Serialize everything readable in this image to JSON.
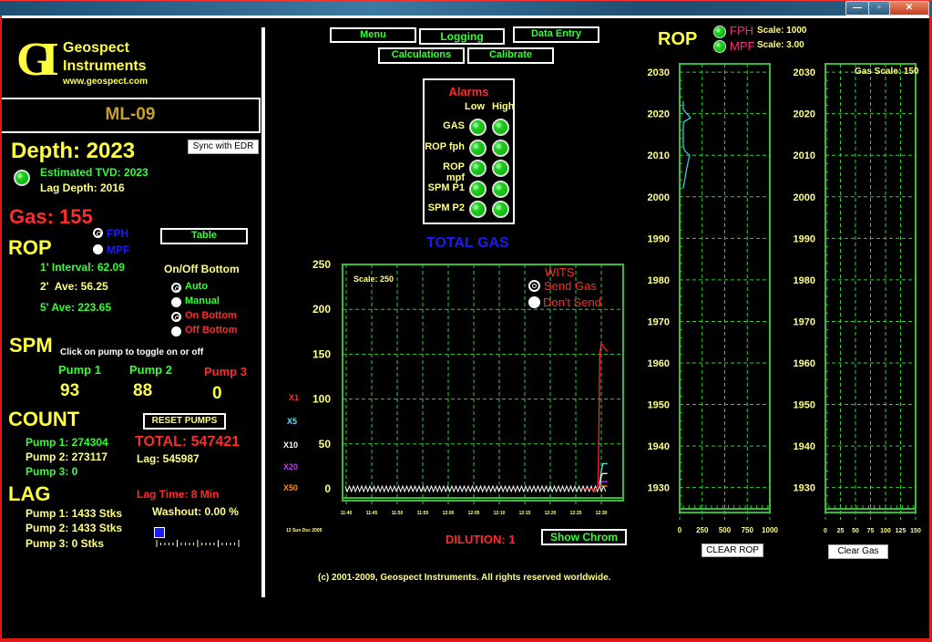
{
  "window": {
    "controls": {
      "minimize": "—",
      "maximize": "▫",
      "close": "✕"
    }
  },
  "brand": {
    "logo_letters": "GI",
    "name_line1": "Geospect",
    "name_line2": "Instruments",
    "url": "www.geospect.com"
  },
  "well_name": "ML-09",
  "depth": {
    "label": "Depth: 2023",
    "sync_button": "Sync with EDR",
    "tvd": "Estimated TVD: 2023",
    "lag_depth": "Lag Depth: 2016"
  },
  "gas": {
    "label": "Gas: 155"
  },
  "rop": {
    "title": "ROP",
    "units": [
      {
        "label": "FPH",
        "selected": true
      },
      {
        "label": "MPF",
        "selected": false
      }
    ],
    "table_button": "Table",
    "interval": "1' Interval: 62.09",
    "ave2": "2'  Ave: 56.25",
    "ave5": "5' Ave: 223.65"
  },
  "onoff_bottom": {
    "title": "On/Off Bottom",
    "options": [
      {
        "label": "Auto",
        "selected": true,
        "color": "#33ff33"
      },
      {
        "label": "Manual",
        "selected": false,
        "color": "#33ff33"
      },
      {
        "label": "On Bottom",
        "selected": true,
        "color": "#ff2a2a"
      },
      {
        "label": "Off Bottom",
        "selected": false,
        "color": "#ff2a2a"
      }
    ]
  },
  "spm": {
    "title": "SPM",
    "hint": "Click on pump to toggle on or off",
    "pumps": [
      {
        "label": "Pump 1",
        "value": "93",
        "color": "#33ff33"
      },
      {
        "label": "Pump 2",
        "value": "88",
        "color": "#33ff33"
      },
      {
        "label": "Pump 3",
        "value": "0",
        "color": "#ff2a2a"
      }
    ]
  },
  "count": {
    "title": "COUNT",
    "reset_button": "RESET PUMPS",
    "pump1": "Pump 1: 274304",
    "pump2": "Pump 2: 273117",
    "pump3": "Pump 3: 0",
    "total": "TOTAL: 547421",
    "lag": "Lag: 545987"
  },
  "lag": {
    "title": "LAG",
    "pump1": "Pump 1: 1433 Stks",
    "pump2": "Pump 2: 1433 Stks",
    "pump3": "Pump 3: 0 Stks",
    "lag_time": "Lag Time: 8 Min",
    "washout": "Washout: 0.00 %",
    "washout_slider_value": 0
  },
  "nav": {
    "menu": "Menu",
    "logging": "Logging",
    "data_entry": "Data Entry",
    "calculations": "Calculations",
    "calibrate": "Calibrate"
  },
  "alarms": {
    "title": "Alarms",
    "col_low": "Low",
    "col_high": "High",
    "rows": [
      "GAS",
      "ROP fph",
      "ROP mpf",
      "SPM P1",
      "SPM P2"
    ]
  },
  "total_gas": {
    "title": "TOTAL GAS",
    "scale_label": "Scale: 250",
    "wits": {
      "title": "WITS",
      "options": [
        {
          "label": "Send Gas",
          "selected": true
        },
        {
          "label": "Don't Send",
          "selected": false
        }
      ]
    },
    "multipliers": [
      {
        "label": "X1",
        "color": "#ff2a2a"
      },
      {
        "label": "X5",
        "color": "#66e0ff"
      },
      {
        "label": "X10",
        "color": "#ffffff"
      },
      {
        "label": "X20",
        "color": "#cc33ff"
      },
      {
        "label": "X50",
        "color": "#ff8c1a"
      }
    ],
    "date": "13 Sun Dec 2009",
    "dilution": "DILUTION: 1",
    "show_chrom_button": "Show Chrom"
  },
  "rop_panel": {
    "title": "ROP",
    "fph_label": "FPH",
    "fph_scale": "Scale: 1000",
    "mpf_label": "MPF",
    "mpf_scale": "Scale: 3.00",
    "clear_button": "CLEAR ROP"
  },
  "gas_panel": {
    "scale_label": "Gas Scale: 150",
    "clear_button": "Clear Gas"
  },
  "copyright": "(c) 2001-2009, Geospect Instruments. All rights reserved worldwide.",
  "chart_data": [
    {
      "type": "line",
      "title": "TOTAL GAS",
      "xlabel": "",
      "ylabel": "",
      "ylim": [
        0,
        250
      ],
      "yticks": [
        0,
        50,
        100,
        150,
        200,
        250
      ],
      "x_tick_labels": [
        "11:40",
        "11:45",
        "11:50",
        "11:55",
        "12:00",
        "12:05",
        "12:10",
        "12:15",
        "12:20",
        "12:25",
        "12:30"
      ],
      "grid": true,
      "series": [
        {
          "name": "X1",
          "color": "#ff2a2a",
          "points": [
            [
              12.44,
              0
            ],
            [
              12.47,
              0
            ],
            [
              12.475,
              -3
            ],
            [
              12.48,
              -3
            ],
            [
              12.49,
              5
            ],
            [
              12.495,
              150
            ],
            [
              12.5,
              162
            ],
            [
              12.51,
              157
            ],
            [
              12.515,
              155
            ],
            [
              12.52,
              153
            ]
          ]
        },
        {
          "name": "X5",
          "color": "#66e0ff",
          "points": [
            [
              12.495,
              5
            ],
            [
              12.5,
              20
            ],
            [
              12.505,
              28
            ],
            [
              12.52,
              28
            ]
          ]
        },
        {
          "name": "X10",
          "color": "#ffffff",
          "points": [
            [
              12.495,
              3
            ],
            [
              12.5,
              15
            ],
            [
              12.505,
              17
            ],
            [
              12.52,
              17
            ]
          ]
        },
        {
          "name": "X20",
          "color": "#cc33ff",
          "points": [
            [
              12.495,
              2
            ],
            [
              12.5,
              8
            ],
            [
              12.52,
              8
            ]
          ]
        },
        {
          "name": "X50",
          "color": "#ff8c1a",
          "points": [
            [
              12.495,
              1
            ],
            [
              12.5,
              3
            ],
            [
              12.52,
              3
            ]
          ]
        },
        {
          "name": "baseline",
          "color": "#ffffff",
          "pattern": "sawtooth",
          "ylim_band": [
            -2,
            2
          ]
        }
      ]
    },
    {
      "type": "line",
      "title": "ROP",
      "xlim": [
        0,
        1000
      ],
      "x_tick_labels": [
        "0",
        "250",
        "500",
        "750",
        "1000"
      ],
      "ylim": [
        1924,
        2032
      ],
      "yticks": [
        2030,
        2020,
        2010,
        2000,
        1990,
        1980,
        1970,
        1960,
        1950,
        1940,
        1930
      ],
      "grid": true,
      "series": [
        {
          "name": "FPH",
          "color": "#33ccdd",
          "points": [
            [
              40,
              2023
            ],
            [
              40,
              2021
            ],
            [
              120,
              2019
            ],
            [
              45,
              2018
            ],
            [
              40,
              2017
            ],
            [
              40,
              2012
            ],
            [
              60,
              2011
            ],
            [
              110,
              2010
            ],
            [
              80,
              2007
            ],
            [
              40,
              2002
            ]
          ]
        }
      ]
    },
    {
      "type": "line",
      "title": "Gas",
      "xlim": [
        0,
        150
      ],
      "x_tick_labels": [
        "0",
        "25",
        "50",
        "75",
        "100",
        "125",
        "150"
      ],
      "ylim": [
        1924,
        2032
      ],
      "yticks": [
        2030,
        2020,
        2010,
        2000,
        1990,
        1980,
        1970,
        1960,
        1950,
        1940,
        1930
      ],
      "grid": true,
      "series": []
    }
  ]
}
